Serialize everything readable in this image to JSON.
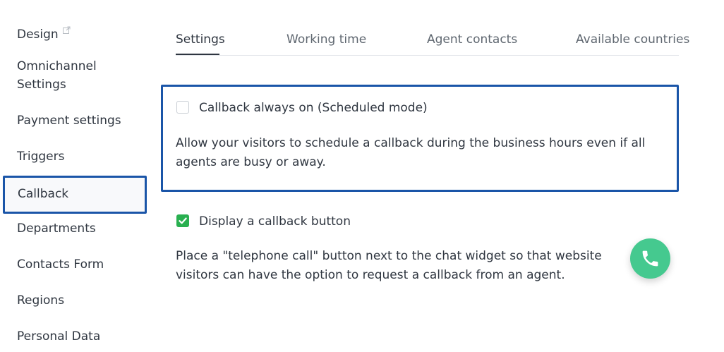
{
  "sidebar": {
    "items": [
      {
        "label": "Design",
        "external": true
      },
      {
        "label": "Omnichannel Settings"
      },
      {
        "label": "Payment settings"
      },
      {
        "label": "Triggers"
      },
      {
        "label": "Callback",
        "active": true
      },
      {
        "label": "Departments"
      },
      {
        "label": "Contacts Form"
      },
      {
        "label": "Regions"
      },
      {
        "label": "Personal Data"
      }
    ]
  },
  "tabs": [
    {
      "label": "Settings",
      "active": true
    },
    {
      "label": "Working time"
    },
    {
      "label": "Agent contacts"
    },
    {
      "label": "Available countries"
    }
  ],
  "scheduled_mode": {
    "checkbox_label": "Callback always on (Scheduled mode)",
    "checked": false,
    "description": "Allow your visitors to schedule a callback during the business hours even if all agents are busy or away."
  },
  "callback_button": {
    "checkbox_label": "Display a callback button",
    "checked": true,
    "description": "Place a \"telephone call\" button next to the chat widget so that website visitors can have the option to request a callback from an agent."
  },
  "colors": {
    "highlight_border": "#1a55a8",
    "checkbox_green": "#29b050",
    "phone_button": "#45c98f"
  },
  "icons": {
    "external_link": "external-link-icon",
    "check": "checkmark-icon",
    "phone": "phone-icon"
  }
}
